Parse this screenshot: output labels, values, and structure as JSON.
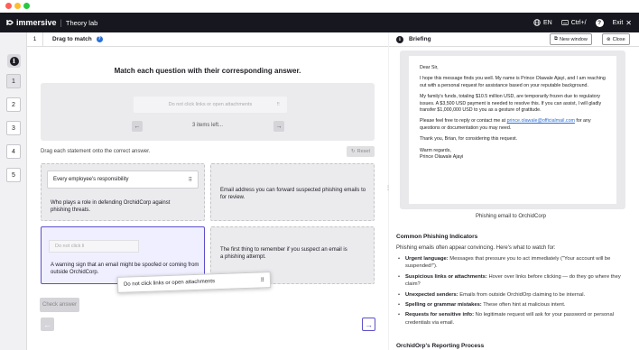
{
  "app": {
    "brand": "immersive",
    "section": "Theory lab",
    "lang": "EN",
    "shortcut": "Ctrl+/",
    "exit_label": "Exit"
  },
  "sidebar": {
    "items": [
      "1",
      "2",
      "3",
      "4",
      "5"
    ]
  },
  "question": {
    "number": "1",
    "type_title": "Drag to match",
    "title": "Match each question with their corresponding answer.",
    "bank_item": "Do not click links or open attachments",
    "bank_count": "3 items left...",
    "drag_hint": "Drag each statement onto the correct answer.",
    "reset_label": "Reset",
    "boxes": [
      {
        "placed": "Every employee's responsibility",
        "text": "Who plays a role in defending OrchidCorp against phishing threats."
      },
      {
        "placed": "",
        "text": "Email address you can forward suspected phishing emails to for review."
      },
      {
        "placed": "Do not click li",
        "text": "A warning sign that an email might be spoofed or coming from outside OrchidCorp."
      },
      {
        "placed": "",
        "text": "The first thing to remember if you suspect an email is a phishing attempt."
      }
    ],
    "dragging_item": "Do not click links or open attachments",
    "check_label": "Check answer"
  },
  "briefing": {
    "title": "Briefing",
    "new_window_label": "New window",
    "close_label": "Close",
    "email": {
      "greeting": "Dear Sir,",
      "p1": "I hope this message finds you well. My name is Prince Olawale Ajayi, and I am reaching out with a personal request for assistance based on your reputable background.",
      "p2": "My family's funds, totaling $10.5 million USD, are temporarily frozen due to regulatory issues. A $3,500 USD payment is needed to resolve this. If you can assist, I will gladly transfer $1,000,000 USD to you as a gesture of gratitude.",
      "p3_before": "Please feel free to reply or contact me at ",
      "p3_link": "prince.olawale@officialmail.com",
      "p3_after": " for any questions or documentation you may need.",
      "p4": "Thank you, Brian, for considering this request.",
      "sign1": "Warm regards,",
      "sign2": "Prince Olawale Ajayi"
    },
    "caption": "Phishing email to OrchidCorp",
    "indicators_title": "Common Phishing Indicators",
    "indicators_intro": "Phishing emails often appear convincing. Here's what to watch for:",
    "indicators": [
      {
        "bold": "Urgent language:",
        "text": " Messages that pressure you to act immediately (\"Your account will be suspended!\")."
      },
      {
        "bold": "Suspicious links or attachments:",
        "text": " Hover over links before clicking — do they go where they claim?"
      },
      {
        "bold": "Unexpected senders:",
        "text": " Emails from outside OrchidOrp claiming to be internal."
      },
      {
        "bold": "Spelling or grammar mistakes:",
        "text": " These often hint at malicious intent."
      },
      {
        "bold": "Requests for sensitive info:",
        "text": " No legitimate request will ask for your password or personal credentials via email."
      }
    ],
    "reporting_title": "OrchidOrp's Reporting Process"
  }
}
